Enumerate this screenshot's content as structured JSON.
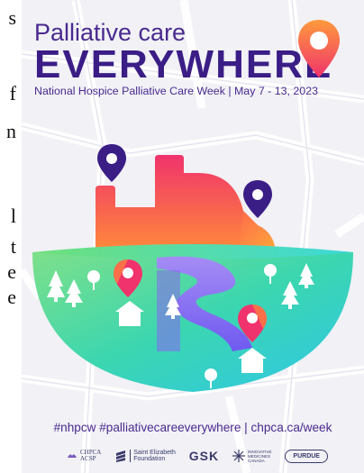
{
  "article_fragments": [
    "s",
    "f",
    "n",
    "l",
    "t",
    "e",
    "e"
  ],
  "poster": {
    "headline_line1": "Palliative care",
    "headline_line2": "EVERYWHERE",
    "subline": "National Hospice Palliative Care Week | May 7 - 13, 2023",
    "hashtags": "#nhpcw #palliativecareeverywhere | chpca.ca/week",
    "sponsors": {
      "chpca_top": "CHPCA",
      "chpca_bottom": "ACSP",
      "saint_elizabeth_top": "Saint Elizabeth",
      "saint_elizabeth_bottom": "Foundation",
      "gsk": "GSK",
      "imc_top": "INNOVATIVE",
      "imc_mid": "MEDICINES",
      "imc_bottom": "CANADA",
      "purdue": "PURDUE"
    }
  },
  "colors": {
    "purple": "#3b1d86",
    "pin_orange": "#ff7a3d",
    "pin_magenta": "#f0336c",
    "ground_green": "#4fd39a",
    "ground_cyan": "#3bd6e0",
    "river_purple": "#8b63f0"
  },
  "icons": [
    "location-pin-icon",
    "house-icon",
    "tree-icon"
  ]
}
